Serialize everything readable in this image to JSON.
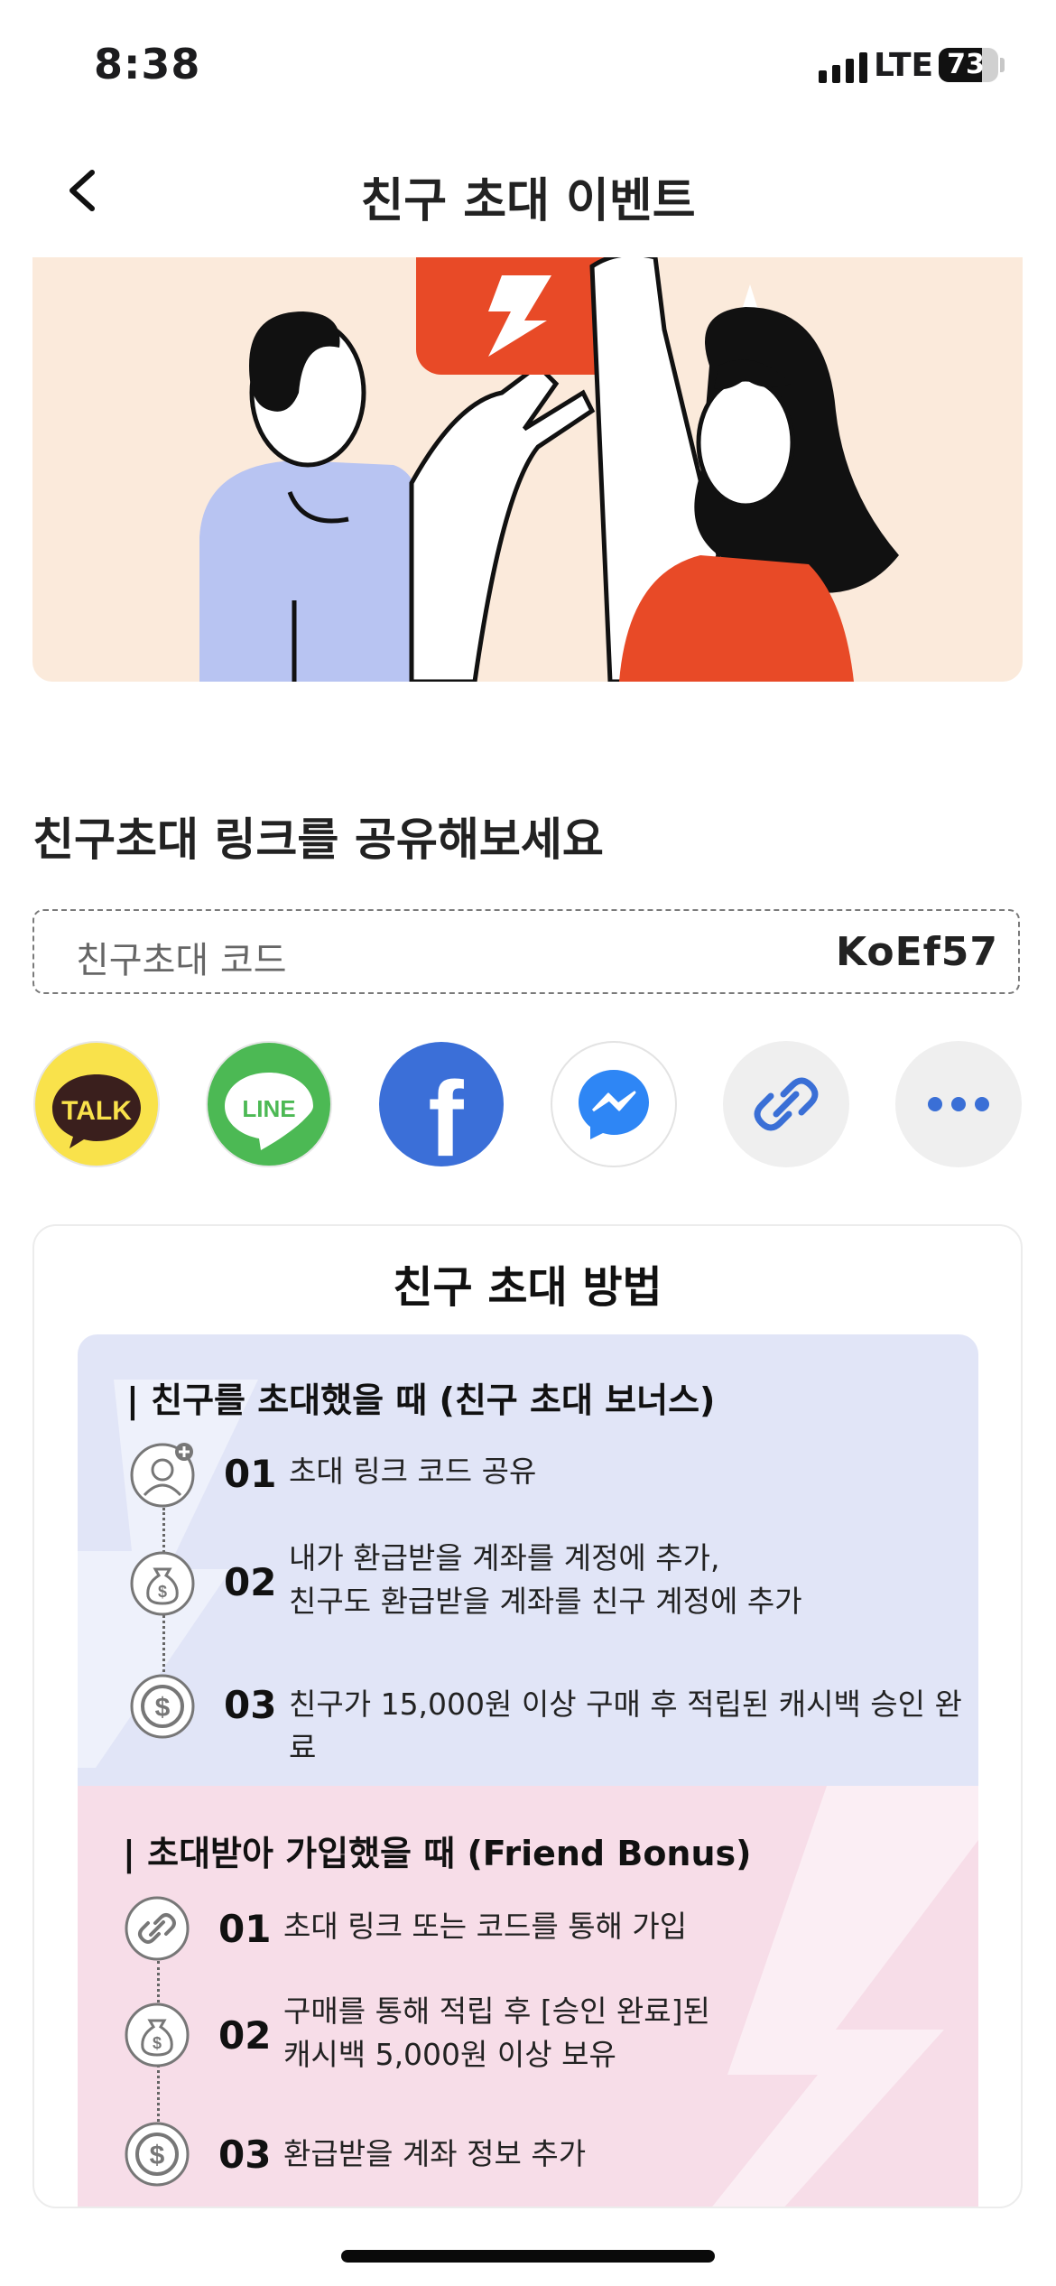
{
  "status_bar": {
    "time": "8:38",
    "network": "LTE",
    "battery": 73
  },
  "header": {
    "title": "친구 초대 이벤트"
  },
  "share_section": {
    "heading": "친구초대 링크를 공유해보세요",
    "code_label": "친구초대 코드",
    "code_value": "KoEf57",
    "buttons": [
      {
        "name": "kakaotalk",
        "label": "TALK",
        "color": "#f9e24b"
      },
      {
        "name": "line",
        "label": "LINE",
        "color": "#4cb954"
      },
      {
        "name": "facebook",
        "label": "f",
        "color": "#3b6fd8"
      },
      {
        "name": "messenger",
        "icon": "messenger-icon",
        "color": "#ffffff"
      },
      {
        "name": "copy-link",
        "icon": "link-icon",
        "color": "#efefef"
      },
      {
        "name": "more",
        "icon": "more-icon",
        "color": "#efefef"
      }
    ]
  },
  "guide": {
    "title": "친구 초대 방법",
    "inviter": {
      "heading": "| 친구를 초대했을 때 (친구 초대 보너스)",
      "steps": [
        {
          "num": "01",
          "text": "초대 링크 코드 공유",
          "icon": "user-add-icon"
        },
        {
          "num": "02",
          "text": "내가 환급받을 계좌를 계정에 추가,\n친구도 환급받을 계좌를 친구 계정에 추가",
          "icon": "money-bag-icon"
        },
        {
          "num": "03",
          "text": "친구가 15,000원 이상 구매 후 적립된 캐시백 승인 완료",
          "icon": "dollar-coin-icon"
        }
      ]
    },
    "invitee": {
      "heading": "| 초대받아 가입했을 때 (Friend Bonus)",
      "steps": [
        {
          "num": "01",
          "text": "초대 링크 또는 코드를 통해 가입",
          "icon": "link-icon"
        },
        {
          "num": "02",
          "text": "구매를 통해 적립 후 [승인 완료]된\n캐시백 5,000원 이상 보유",
          "icon": "money-bag-icon"
        },
        {
          "num": "03",
          "text": "환급받을 계좌 정보 추가",
          "icon": "dollar-coin-icon"
        }
      ]
    }
  },
  "colors": {
    "accent": "#e84a27",
    "blue_panel": "#e1e5f7",
    "pink_panel": "#f7dde8"
  }
}
